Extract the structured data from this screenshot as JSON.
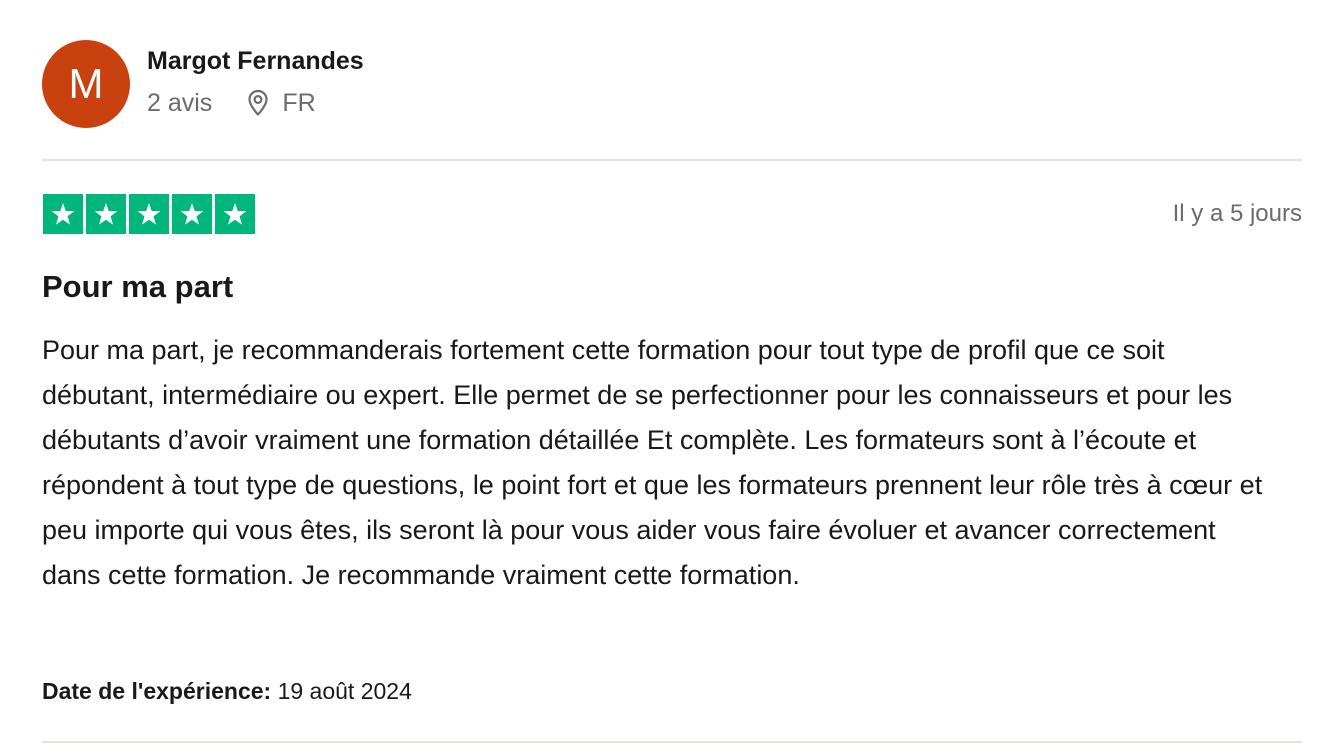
{
  "consumer": {
    "avatar_initial": "M",
    "name": "Margot Fernandes",
    "review_count": "2 avis",
    "country": "FR",
    "avatar_color": "#c9410f"
  },
  "review": {
    "rating": 5,
    "rating_max": 5,
    "star_color": "#00b67a",
    "date_relative": "Il y a 5 jours",
    "title": "Pour ma part",
    "text": "Pour ma part, je recommanderais fortement cette formation pour tout type de profil que ce soit débutant, intermédiaire ou expert. Elle permet de se perfectionner pour les connaisseurs et pour les débutants d’avoir vraiment une formation détaillée Et complète. Les formateurs sont à l’écoute et répondent à tout type de questions, le point fort et que les formateurs prennent leur rôle très à cœur et peu importe qui vous êtes, ils seront là pour vous aider vous faire évoluer et avancer correctement dans cette formation. Je recommande vraiment cette formation.",
    "experience_label": "Date de l'expérience:",
    "experience_date": "19 août 2024"
  },
  "icons": {
    "location": "location-pin-icon",
    "star": "star-icon"
  }
}
